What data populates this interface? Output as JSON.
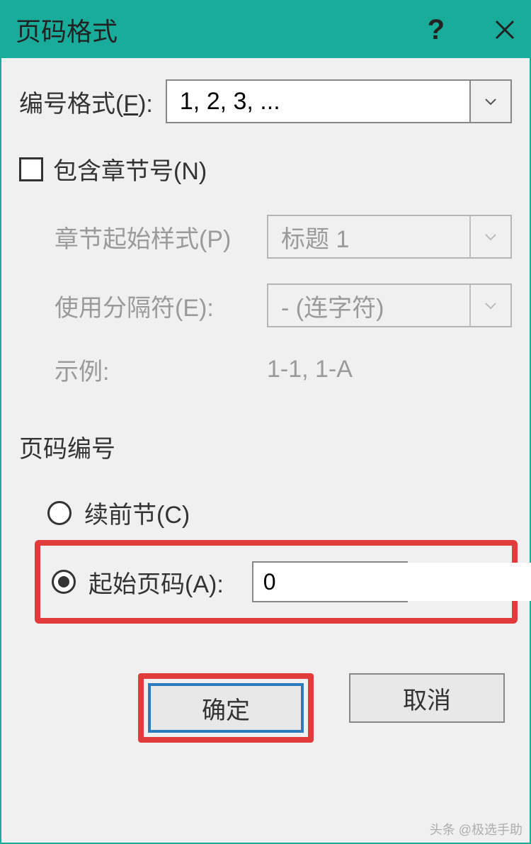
{
  "title": "页码格式",
  "number_format": {
    "label_prefix": "编号格式(",
    "hotkey": "F",
    "label_suffix": "):",
    "value": "1, 2, 3, ..."
  },
  "include_chapter": {
    "label_prefix": "包含章节号(",
    "hotkey": "N",
    "label_suffix": ")",
    "checked": false
  },
  "chapter_start_style": {
    "label": "章节起始样式(P)",
    "value": "标题 1"
  },
  "separator": {
    "label": "使用分隔符(E):",
    "value": "-  (连字符)"
  },
  "example": {
    "label": "示例:",
    "value": "1-1, 1-A"
  },
  "page_numbering": {
    "section_title": "页码编号",
    "continue": {
      "label_prefix": "续前节(",
      "hotkey": "C",
      "label_suffix": ")",
      "selected": false
    },
    "start_at": {
      "label_prefix": "起始页码(",
      "hotkey": "A",
      "label_suffix": "):",
      "selected": true,
      "value": "0"
    }
  },
  "buttons": {
    "ok": "确定",
    "cancel": "取消"
  },
  "watermark": "头条 @极选手助"
}
